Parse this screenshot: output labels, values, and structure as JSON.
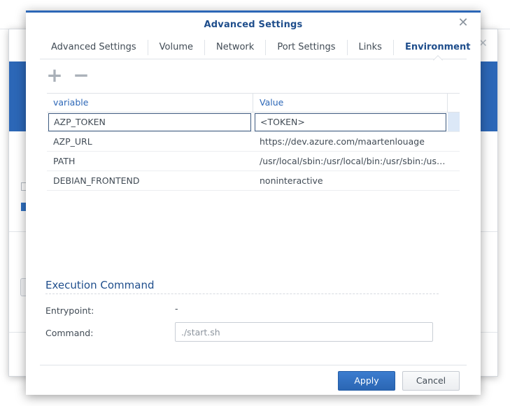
{
  "dialog": {
    "title": "Advanced Settings",
    "close_icon": "close-icon"
  },
  "tabs": [
    {
      "label": "Advanced Settings",
      "active": false
    },
    {
      "label": "Volume",
      "active": false
    },
    {
      "label": "Network",
      "active": false
    },
    {
      "label": "Port Settings",
      "active": false
    },
    {
      "label": "Links",
      "active": false
    },
    {
      "label": "Environment",
      "active": true
    }
  ],
  "toolbar": {
    "add_icon": "+",
    "remove_icon": "−"
  },
  "grid": {
    "columns": [
      "variable",
      "Value"
    ],
    "rows": [
      {
        "variable": "AZP_TOKEN",
        "value": "<TOKEN>",
        "selected": true
      },
      {
        "variable": "AZP_URL",
        "value": "https://dev.azure.com/maartenlouage"
      },
      {
        "variable": "PATH",
        "value": "/usr/local/sbin:/usr/local/bin:/usr/sbin:/usr/bin:/sbin:/bin"
      },
      {
        "variable": "DEBIAN_FRONTEND",
        "value": "noninteractive"
      }
    ]
  },
  "execution": {
    "title": "Execution Command",
    "entrypoint_label": "Entrypoint:",
    "entrypoint_value": "-",
    "command_label": "Command:",
    "command_placeholder": "./start.sh"
  },
  "buttons": {
    "apply": "Apply",
    "cancel": "Cancel"
  },
  "colors": {
    "accent": "#2c67b7",
    "title": "#1f4e8c",
    "apply_button": "#2f6fc0"
  }
}
